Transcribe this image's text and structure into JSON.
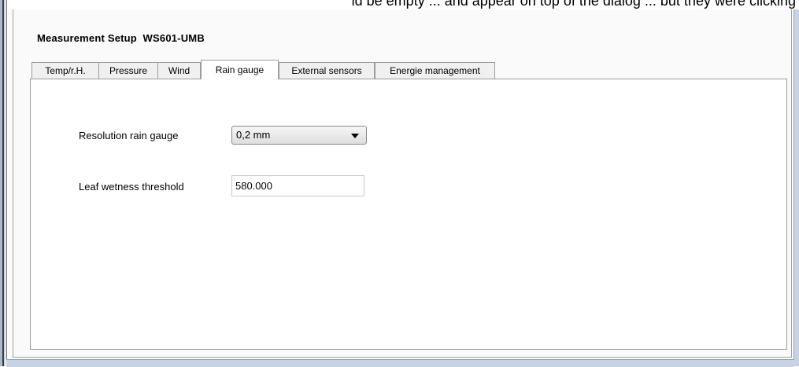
{
  "background_text": "ld be empty ... and appear on top of the dialog ... but they were clicking",
  "dialog": {
    "title": "Measurement Setup  WS601-UMB"
  },
  "tabs": [
    {
      "label": "Temp/r.H.",
      "active": false
    },
    {
      "label": "Pressure",
      "active": false
    },
    {
      "label": "Wind",
      "active": false
    },
    {
      "label": "Rain gauge",
      "active": true
    },
    {
      "label": "External sensors",
      "active": false
    },
    {
      "label": "Energie management",
      "active": false
    }
  ],
  "fields": {
    "resolution": {
      "label": "Resolution rain gauge",
      "value": "0,2 mm",
      "icon": "chevron-down-icon"
    },
    "leaf_wetness": {
      "label": "Leaf wetness threshold",
      "value": "580.000"
    }
  },
  "colors": {
    "panel_border": "#9c9c9c",
    "inactive_tab_bg": "#f0f0f0",
    "active_tab_bg": "#ffffff"
  }
}
